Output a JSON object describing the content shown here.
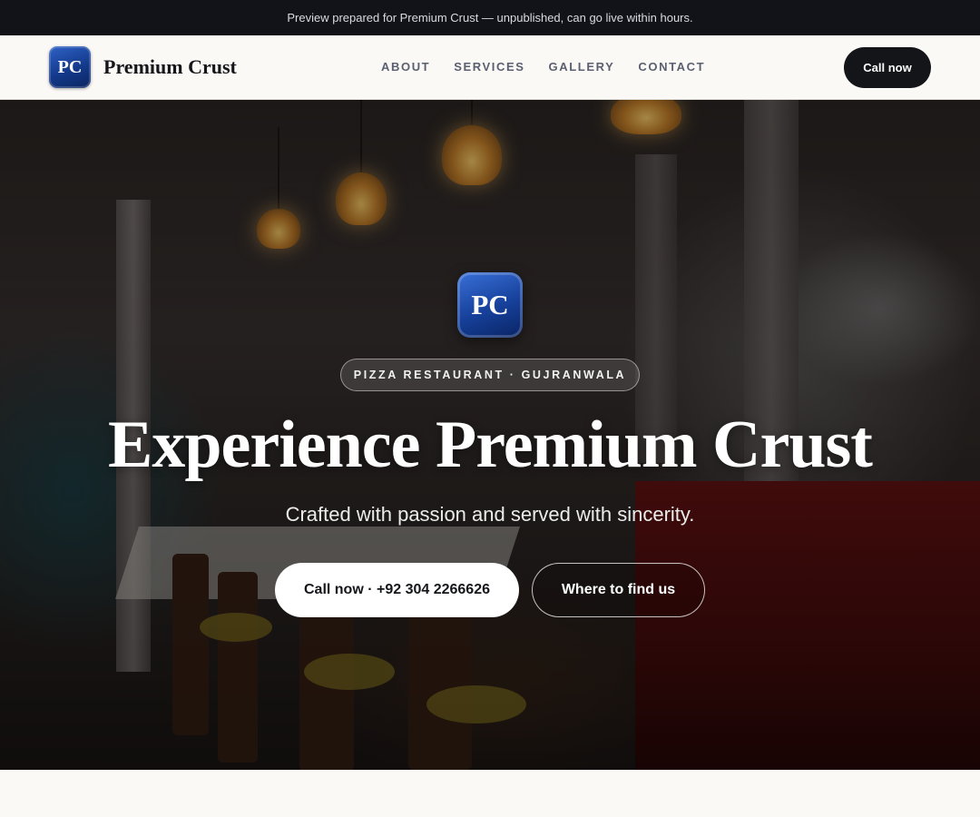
{
  "announcement": "Preview prepared for Premium Crust — unpublished, can go live within hours.",
  "header": {
    "logo_initials": "PC",
    "brand_name": "Premium Crust",
    "nav": [
      "ABOUT",
      "SERVICES",
      "GALLERY",
      "CONTACT"
    ],
    "cta_label": "Call now"
  },
  "hero": {
    "logo_initials": "PC",
    "tagline": "PIZZA RESTAURANT · GUJRANWALA",
    "title": "Experience Premium Crust",
    "subtitle": "Crafted with passion and served with sincerity.",
    "primary_button": "Call now · +92 304 2266626",
    "secondary_button": "Where to find us"
  },
  "colors": {
    "topbar_bg": "#111318",
    "page_bg": "#faf9f6",
    "logo_blue": "#143a8c",
    "cta_dark": "#141519"
  }
}
